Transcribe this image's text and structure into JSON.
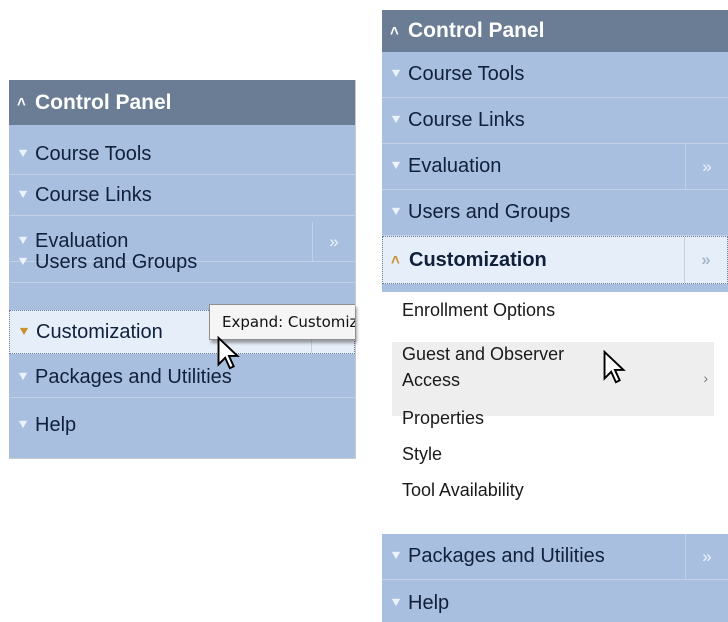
{
  "left_panel": {
    "header": "Control Panel",
    "items": [
      {
        "label": "Course Tools"
      },
      {
        "label": "Course Links"
      },
      {
        "label": "Evaluation"
      },
      {
        "label": "Users and Groups"
      },
      {
        "label": "Customization"
      },
      {
        "label": "Packages and Utilities"
      },
      {
        "label": "Help"
      }
    ],
    "tooltip": "Expand: Customization"
  },
  "right_panel": {
    "header": "Control Panel",
    "items": [
      {
        "label": "Course Tools"
      },
      {
        "label": "Course Links"
      },
      {
        "label": "Evaluation"
      },
      {
        "label": "Users and Groups"
      },
      {
        "label": "Customization"
      }
    ],
    "submenu": [
      {
        "label": "Enrollment Options"
      },
      {
        "label": "Guest and Observer"
      },
      {
        "label": "Access"
      },
      {
        "label": "Properties"
      },
      {
        "label": "Style"
      },
      {
        "label": "Tool Availability"
      }
    ],
    "footer_items": [
      {
        "label": "Packages and Utilities"
      },
      {
        "label": "Help"
      }
    ]
  },
  "icons": {
    "expand": "double-chevron-down-icon",
    "collapse": "double-chevron-up-icon",
    "flyout": "double-chevron-right-icon"
  },
  "colors": {
    "panel_bg": "#a9bfdf",
    "header_bg": "#6a7d94",
    "highlight_bg": "#e6eef9",
    "caret_gold": "#c8912a"
  }
}
